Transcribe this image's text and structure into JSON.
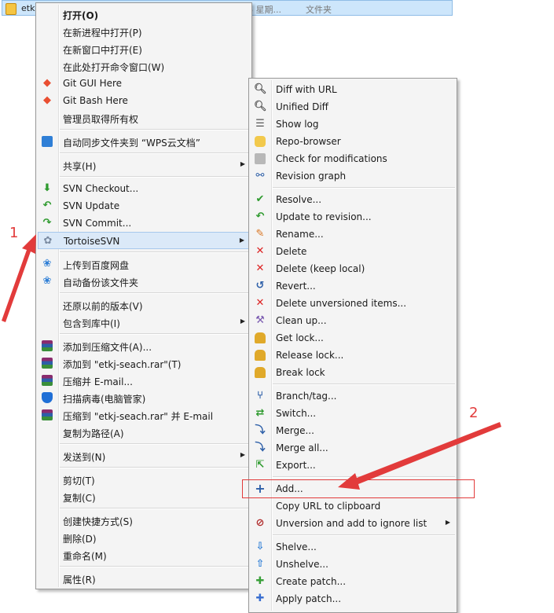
{
  "file_row": {
    "name": "etk",
    "date": "6 星期...",
    "type": "文件夹"
  },
  "main_menu": {
    "items": [
      {
        "label": "打开(O)",
        "bold": true,
        "icon": ""
      },
      {
        "label": "在新进程中打开(P)",
        "icon": ""
      },
      {
        "label": "在新窗口中打开(E)",
        "icon": ""
      },
      {
        "label": "在此处打开命令窗口(W)",
        "icon": ""
      },
      {
        "label": "Git GUI Here",
        "icon": "git-icon"
      },
      {
        "label": "Git Bash Here",
        "icon": "git-icon"
      },
      {
        "label": "管理员取得所有权",
        "icon": ""
      },
      {
        "label": "自动同步文件夹到 “WPS云文档”",
        "icon": "wps-sync-icon"
      },
      {
        "label": "共享(H)",
        "icon": "",
        "submenu": true
      },
      {
        "label": "SVN Checkout...",
        "icon": "svn-checkout-icon"
      },
      {
        "label": "SVN Update",
        "icon": "svn-update-icon"
      },
      {
        "label": "SVN Commit...",
        "icon": "svn-commit-icon"
      },
      {
        "label": "TortoiseSVN",
        "icon": "tortoise-icon",
        "submenu": true
      },
      {
        "label": "上传到百度网盘",
        "icon": "baidu-icon"
      },
      {
        "label": "自动备份该文件夹",
        "icon": "baidu-icon"
      },
      {
        "label": "还原以前的版本(V)",
        "icon": ""
      },
      {
        "label": "包含到库中(I)",
        "icon": "",
        "submenu": true
      },
      {
        "label": "添加到压缩文件(A)...",
        "icon": "rar-icon"
      },
      {
        "label": "添加到 \"etkj-seach.rar\"(T)",
        "icon": "rar-icon"
      },
      {
        "label": "压缩并 E-mail...",
        "icon": "rar-icon"
      },
      {
        "label": "扫描病毒(电脑管家)",
        "icon": "shield-icon"
      },
      {
        "label": "压缩到 \"etkj-seach.rar\" 并 E-mail",
        "icon": "rar-icon"
      },
      {
        "label": "复制为路径(A)",
        "icon": ""
      },
      {
        "label": "发送到(N)",
        "icon": "",
        "submenu": true
      },
      {
        "label": "剪切(T)",
        "icon": ""
      },
      {
        "label": "复制(C)",
        "icon": ""
      },
      {
        "label": "创建快捷方式(S)",
        "icon": ""
      },
      {
        "label": "删除(D)",
        "icon": ""
      },
      {
        "label": "重命名(M)",
        "icon": ""
      },
      {
        "label": "属性(R)",
        "icon": ""
      }
    ]
  },
  "svn_menu": {
    "items": [
      {
        "label": "Diff with URL",
        "icon": "magnifier-icon"
      },
      {
        "label": "Unified Diff",
        "icon": "magnifier-icon"
      },
      {
        "label": "Show log",
        "icon": "log-icon"
      },
      {
        "label": "Repo-browser",
        "icon": "repo-icon"
      },
      {
        "label": "Check for modifications",
        "icon": "check-mod-icon"
      },
      {
        "label": "Revision graph",
        "icon": "graph-icon"
      },
      {
        "label": "Resolve...",
        "icon": "resolve-icon"
      },
      {
        "label": "Update to revision...",
        "icon": "update-icon"
      },
      {
        "label": "Rename...",
        "icon": "rename-icon"
      },
      {
        "label": "Delete",
        "icon": "delete-icon"
      },
      {
        "label": "Delete (keep local)",
        "icon": "delete-icon"
      },
      {
        "label": "Revert...",
        "icon": "revert-icon"
      },
      {
        "label": "Delete unversioned items...",
        "icon": "delete-icon"
      },
      {
        "label": "Clean up...",
        "icon": "cleanup-icon"
      },
      {
        "label": "Get lock...",
        "icon": "lock-icon"
      },
      {
        "label": "Release lock...",
        "icon": "lock-icon"
      },
      {
        "label": "Break lock",
        "icon": "lock-icon"
      },
      {
        "label": "Branch/tag...",
        "icon": "branch-icon"
      },
      {
        "label": "Switch...",
        "icon": "switch-icon"
      },
      {
        "label": "Merge...",
        "icon": "merge-icon"
      },
      {
        "label": "Merge all...",
        "icon": "merge-icon"
      },
      {
        "label": "Export...",
        "icon": "export-icon"
      },
      {
        "label": "Add...",
        "icon": "add-icon"
      },
      {
        "label": "Copy URL to clipboard",
        "icon": ""
      },
      {
        "label": "Unversion and add to ignore list",
        "icon": "ignore-icon",
        "submenu": true
      },
      {
        "label": "Shelve...",
        "icon": "shelve-icon"
      },
      {
        "label": "Unshelve...",
        "icon": "unshelve-icon"
      },
      {
        "label": "Create patch...",
        "icon": "patch-icon"
      },
      {
        "label": "Apply patch...",
        "icon": "patch-icon"
      }
    ]
  },
  "annotations": {
    "label_1": "1",
    "label_2": "2"
  },
  "colors": {
    "annotation": "#e23b3b",
    "highlight": "#dbe9f8"
  }
}
